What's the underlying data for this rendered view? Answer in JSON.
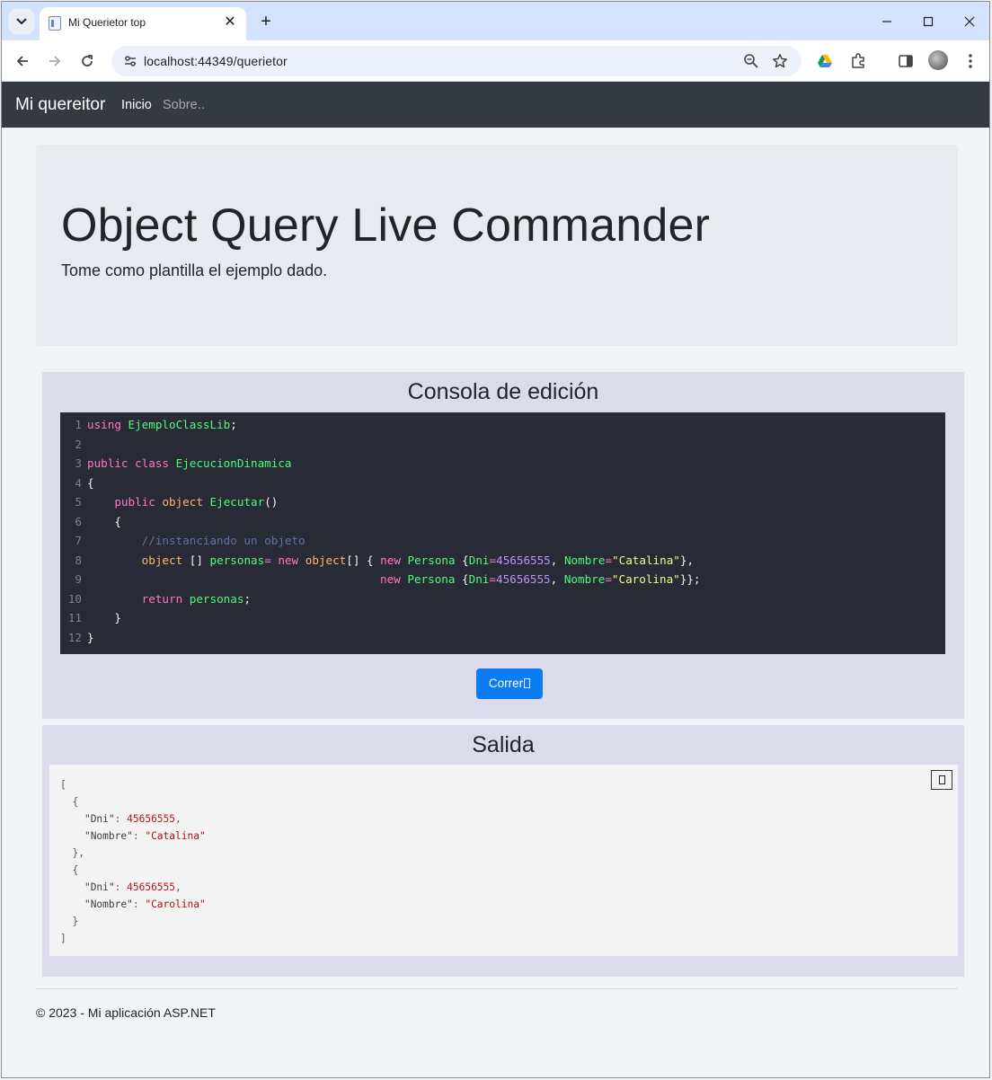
{
  "browser": {
    "tab_title": "Mi Querietor top",
    "url": "localhost:44349/querietor",
    "tab_close": "✕",
    "new_tab": "+"
  },
  "navbar": {
    "brand": "Mi quereitor",
    "links": [
      "Inicio",
      "Sobre.."
    ]
  },
  "hero": {
    "title": "Object Query Live Commander",
    "lead": "Tome como plantilla el ejemplo dado."
  },
  "editor": {
    "title": "Consola de edición",
    "run_label": "Correr",
    "line_numbers": [
      "1",
      "2",
      "3",
      "4",
      "5",
      "6",
      "7",
      "8",
      "9",
      "10",
      "11",
      "12"
    ],
    "lines": [
      "using EjemploClassLib;",
      "",
      "public class EjecucionDinamica",
      "{",
      "    public object Ejecutar()",
      "    {",
      "        //instanciando un objeto",
      "        object [] personas= new object[] { new Persona {Dni=45656555, Nombre=\"Catalina\"},",
      "                                           new Persona {Dni=45656555, Nombre=\"Carolina\"}};",
      "        return personas;",
      "    }",
      "}"
    ]
  },
  "output": {
    "title": "Salida",
    "lines": [
      "[",
      "  {",
      "    \"Dni\": 45656555,",
      "    \"Nombre\": \"Catalina\"",
      "  },",
      "  {",
      "    \"Dni\": 45656555,",
      "    \"Nombre\": \"Carolina\"",
      "  }",
      "]"
    ]
  },
  "footer": {
    "text": "© 2023 - Mi aplicación ASP.NET"
  },
  "colors": {
    "navbar": "#343a40",
    "run_button": "#0d7cf2",
    "code_background": "#282a36",
    "card_background": "#dcdbec"
  },
  "icons": [
    "tab-search-icon",
    "document-icon",
    "close-icon",
    "plus-icon",
    "minimize-icon",
    "maximize-icon",
    "window-close-icon",
    "back-icon",
    "forward-icon",
    "reload-icon",
    "site-info-icon",
    "zoom-icon",
    "star-icon",
    "drive-icon",
    "extensions-icon",
    "side-panel-icon",
    "menu-icon",
    "copy-icon"
  ]
}
